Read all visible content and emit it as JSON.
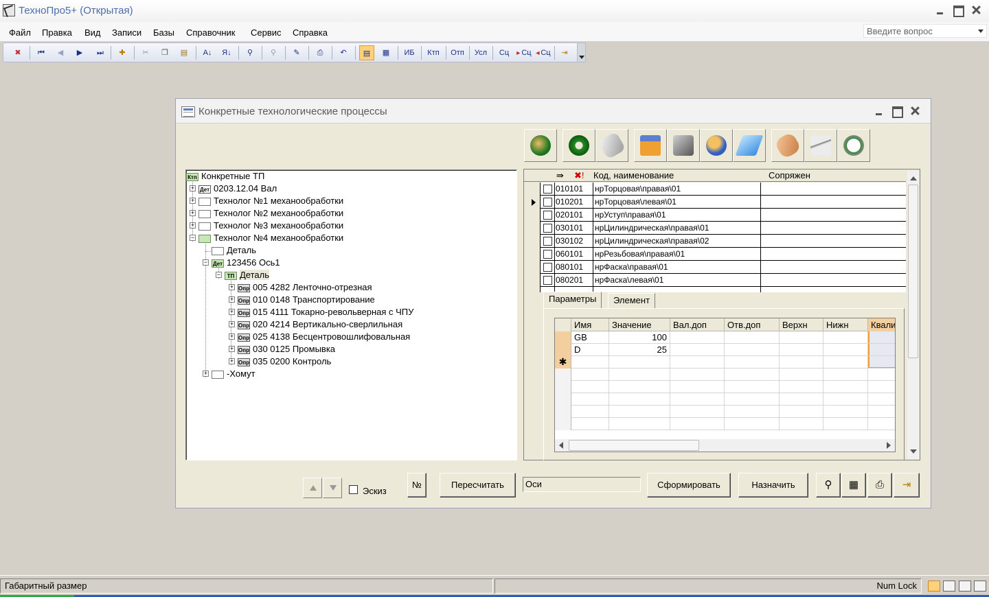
{
  "app": {
    "title": "ТехноПро5+ (Открытая)"
  },
  "menu": {
    "items": [
      {
        "label": "Файл"
      },
      {
        "label": "Правка"
      },
      {
        "label": "Вид"
      },
      {
        "label": "Записи"
      },
      {
        "label": "Базы"
      },
      {
        "label": "Справочник"
      },
      {
        "label": "Сервис"
      },
      {
        "label": "Справка"
      }
    ],
    "ask_placeholder": "Введите вопрос"
  },
  "toolbar": {
    "text_buttons": [
      "ИБ",
      "Ктп",
      "Отп",
      "Усл",
      "Сц",
      "Сц",
      "Сц"
    ]
  },
  "window": {
    "title": "Конкретные технологические процессы"
  },
  "tree": {
    "nodes": [
      {
        "icon": "Ктп",
        "label": "Конкретные ТП"
      },
      {
        "icon": "Дет",
        "label": "0203.12.04 Вал"
      },
      {
        "icon": "",
        "label": "Технолог №1 механообработки"
      },
      {
        "icon": "",
        "label": "Технолог №2 механообработки"
      },
      {
        "icon": "",
        "label": "Технолог №3 механообработки"
      },
      {
        "icon": "",
        "label": "Технолог №4 механообработки"
      },
      {
        "icon": "",
        "label": "Деталь"
      },
      {
        "icon": "Дет",
        "label": "123456 Ось1"
      },
      {
        "icon": "ТП",
        "label": "Деталь"
      },
      {
        "icon": "Опр",
        "label": "005 4282 Ленточно-отрезная"
      },
      {
        "icon": "Опр",
        "label": "010 0148 Транспортирование"
      },
      {
        "icon": "Опр",
        "label": "015 4111 Токарно-револьверная с ЧПУ"
      },
      {
        "icon": "Опр",
        "label": "020 4214 Вертикально-сверлильная"
      },
      {
        "icon": "Опр",
        "label": "025 4138 Бесцентровошлифовальная"
      },
      {
        "icon": "Опр",
        "label": "030 0125 Промывка"
      },
      {
        "icon": "Опр",
        "label": "035 0200 Контроль"
      },
      {
        "icon": "",
        "label": "-Хомут"
      }
    ]
  },
  "grid": {
    "headers": {
      "code_name": "Код, наименование",
      "mate": "Сопряжен"
    },
    "rows": [
      {
        "code": "010101",
        "name": "нрТорцовая\\правая\\01"
      },
      {
        "code": "010201",
        "name": "нрТорцовая\\левая\\01"
      },
      {
        "code": "020101",
        "name": "нрУступ\\правая\\01"
      },
      {
        "code": "030101",
        "name": "нрЦилиндрическая\\правая\\01"
      },
      {
        "code": "030102",
        "name": "нрЦилиндрическая\\правая\\02"
      },
      {
        "code": "060101",
        "name": "нрРезьбовая\\правая\\01"
      },
      {
        "code": "080101",
        "name": "нрФаска\\правая\\01"
      },
      {
        "code": "080201",
        "name": "нрФаска\\левая\\01"
      }
    ]
  },
  "tabs": [
    {
      "label": "Параметры"
    },
    {
      "label": "Элемент"
    }
  ],
  "params": {
    "headers": [
      "Имя",
      "Значение",
      "Вал.доп",
      "Отв.доп",
      "Верхн",
      "Нижн",
      "Квали"
    ],
    "rows": [
      {
        "name": "GB",
        "value": "100"
      },
      {
        "name": "D",
        "value": "25"
      }
    ]
  },
  "bottom": {
    "sketch_label": "Эскиз",
    "number_label": "№",
    "recalc_label": "Пересчитать",
    "axes_value": "Оси",
    "form_label": "Сформировать",
    "assign_label": "Назначить"
  },
  "status": {
    "left_text": "Габаритный размер",
    "numlock": "Num Lock"
  }
}
